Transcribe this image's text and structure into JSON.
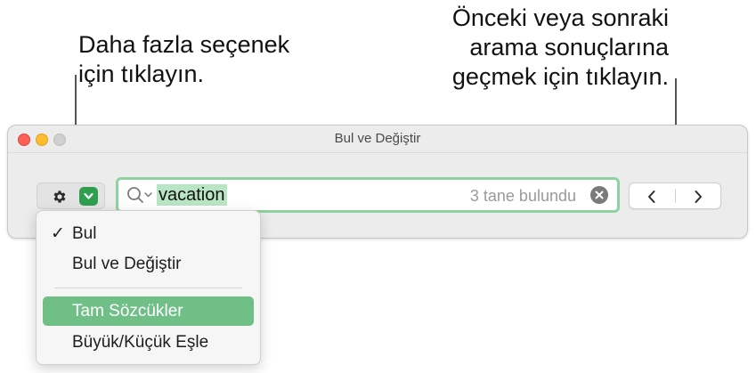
{
  "callouts": {
    "left": [
      "Daha fazla seçenek",
      "için tıklayın."
    ],
    "right": [
      "Önceki veya sonraki",
      "arama sonuçlarına",
      "geçmek için tıklayın."
    ]
  },
  "window": {
    "title": "Bul ve Değiştir"
  },
  "search": {
    "value": "vacation",
    "result_count": "3 tane bulundu"
  },
  "menu": {
    "items": [
      {
        "label": "Bul",
        "checked": "✓"
      },
      {
        "label": "Bul ve Değiştir"
      },
      {
        "label": "Tam Sözcükler"
      },
      {
        "label": "Büyük/Küçük Eşle"
      }
    ]
  },
  "colors": {
    "accent": "#2f9e4f",
    "field_border": "#8fd1a0",
    "highlight": "#6fbf87",
    "close": "#fe5f57",
    "minimize": "#febc2e"
  },
  "icons": {
    "options": "gear-icon",
    "options_menu": "chevron-down-icon",
    "search": "search-icon",
    "clear": "clear-icon",
    "previous": "chevron-left-icon",
    "next": "chevron-right-icon"
  }
}
